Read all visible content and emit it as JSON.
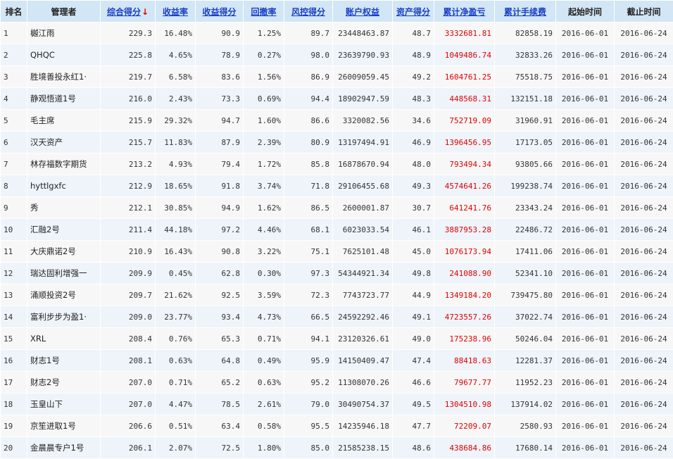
{
  "table": {
    "headers": {
      "rank": "排名",
      "manager": "管理者",
      "composite": "综合得分",
      "composite_arrow": "↓",
      "return_rate": "收益率",
      "return_score": "收益得分",
      "drawdown": "回撤率",
      "risk_score": "风控得分",
      "equity": "账户权益",
      "asset_score": "资产得分",
      "net_pnl": "累计净盈亏",
      "fees": "累计手续费",
      "start": "起始时间",
      "end": "截止时间"
    },
    "rows": [
      {
        "rank": "1",
        "manager": "樾江雨",
        "composite": "229.3",
        "return_rate": "16.48%",
        "return_score": "90.9",
        "drawdown": "1.25%",
        "risk_score": "89.7",
        "equity": "23448463.87",
        "asset_score": "48.7",
        "net_pnl": "3332681.81",
        "fees": "82858.19",
        "start": "2016-06-01",
        "end": "2016-06-24"
      },
      {
        "rank": "2",
        "manager": "QHQC",
        "composite": "225.8",
        "return_rate": "4.65%",
        "return_score": "78.9",
        "drawdown": "0.27%",
        "risk_score": "98.0",
        "equity": "23639790.93",
        "asset_score": "48.9",
        "net_pnl": "1049486.74",
        "fees": "32833.26",
        "start": "2016-06-01",
        "end": "2016-06-24"
      },
      {
        "rank": "3",
        "manager": "胜境善投永红1·",
        "composite": "219.7",
        "return_rate": "6.58%",
        "return_score": "83.6",
        "drawdown": "1.56%",
        "risk_score": "86.9",
        "equity": "26009059.45",
        "asset_score": "49.2",
        "net_pnl": "1604761.25",
        "fees": "75518.75",
        "start": "2016-06-01",
        "end": "2016-06-24"
      },
      {
        "rank": "4",
        "manager": "静观悟道1号",
        "composite": "216.0",
        "return_rate": "2.43%",
        "return_score": "73.3",
        "drawdown": "0.69%",
        "risk_score": "94.4",
        "equity": "18902947.59",
        "asset_score": "48.3",
        "net_pnl": "448568.31",
        "fees": "132151.18",
        "start": "2016-06-01",
        "end": "2016-06-24"
      },
      {
        "rank": "5",
        "manager": "毛主席",
        "composite": "215.9",
        "return_rate": "29.32%",
        "return_score": "94.7",
        "drawdown": "1.60%",
        "risk_score": "86.6",
        "equity": "3320082.56",
        "asset_score": "34.6",
        "net_pnl": "752719.09",
        "fees": "31960.91",
        "start": "2016-06-01",
        "end": "2016-06-24"
      },
      {
        "rank": "6",
        "manager": "汉天资产",
        "composite": "215.7",
        "return_rate": "11.83%",
        "return_score": "87.9",
        "drawdown": "2.39%",
        "risk_score": "80.9",
        "equity": "13197494.91",
        "asset_score": "46.9",
        "net_pnl": "1396456.95",
        "fees": "17173.05",
        "start": "2016-06-01",
        "end": "2016-06-24"
      },
      {
        "rank": "7",
        "manager": "林存福数字期货",
        "composite": "213.2",
        "return_rate": "4.93%",
        "return_score": "79.4",
        "drawdown": "1.72%",
        "risk_score": "85.8",
        "equity": "16878670.94",
        "asset_score": "48.0",
        "net_pnl": "793494.34",
        "fees": "93805.66",
        "start": "2016-06-01",
        "end": "2016-06-24"
      },
      {
        "rank": "8",
        "manager": "hyttlgxfc",
        "composite": "212.9",
        "return_rate": "18.65%",
        "return_score": "91.8",
        "drawdown": "3.74%",
        "risk_score": "71.8",
        "equity": "29106455.68",
        "asset_score": "49.3",
        "net_pnl": "4574641.26",
        "fees": "199238.74",
        "start": "2016-06-01",
        "end": "2016-06-24"
      },
      {
        "rank": "9",
        "manager": "秀",
        "composite": "212.1",
        "return_rate": "30.85%",
        "return_score": "94.9",
        "drawdown": "1.62%",
        "risk_score": "86.5",
        "equity": "2600001.87",
        "asset_score": "30.7",
        "net_pnl": "641241.76",
        "fees": "23343.24",
        "start": "2016-06-01",
        "end": "2016-06-24"
      },
      {
        "rank": "10",
        "manager": "汇融2号",
        "composite": "211.4",
        "return_rate": "44.18%",
        "return_score": "97.2",
        "drawdown": "4.46%",
        "risk_score": "68.1",
        "equity": "6023033.54",
        "asset_score": "46.1",
        "net_pnl": "3887953.28",
        "fees": "22486.72",
        "start": "2016-06-01",
        "end": "2016-06-24"
      },
      {
        "rank": "11",
        "manager": "大庆鼎诺2号",
        "composite": "210.9",
        "return_rate": "16.43%",
        "return_score": "90.8",
        "drawdown": "3.22%",
        "risk_score": "75.1",
        "equity": "7625101.48",
        "asset_score": "45.0",
        "net_pnl": "1076173.94",
        "fees": "17411.06",
        "start": "2016-06-01",
        "end": "2016-06-24"
      },
      {
        "rank": "12",
        "manager": "瑞达固利增强一",
        "composite": "209.9",
        "return_rate": "0.45%",
        "return_score": "62.8",
        "drawdown": "0.30%",
        "risk_score": "97.3",
        "equity": "54344921.34",
        "asset_score": "49.8",
        "net_pnl": "241088.90",
        "fees": "52341.10",
        "start": "2016-06-01",
        "end": "2016-06-24"
      },
      {
        "rank": "13",
        "manager": "涌顺投资2号",
        "composite": "209.7",
        "return_rate": "21.62%",
        "return_score": "92.5",
        "drawdown": "3.59%",
        "risk_score": "72.3",
        "equity": "7743723.77",
        "asset_score": "44.9",
        "net_pnl": "1349184.20",
        "fees": "739475.80",
        "start": "2016-06-01",
        "end": "2016-06-24"
      },
      {
        "rank": "14",
        "manager": "富利步步为盈1·",
        "composite": "209.0",
        "return_rate": "23.77%",
        "return_score": "93.4",
        "drawdown": "4.73%",
        "risk_score": "66.5",
        "equity": "24592292.46",
        "asset_score": "49.1",
        "net_pnl": "4723557.26",
        "fees": "37022.74",
        "start": "2016-06-01",
        "end": "2016-06-24"
      },
      {
        "rank": "15",
        "manager": "XRL",
        "composite": "208.4",
        "return_rate": "0.76%",
        "return_score": "65.3",
        "drawdown": "0.71%",
        "risk_score": "94.1",
        "equity": "23120326.61",
        "asset_score": "49.0",
        "net_pnl": "175238.96",
        "fees": "50246.04",
        "start": "2016-06-01",
        "end": "2016-06-24"
      },
      {
        "rank": "16",
        "manager": "财志1号",
        "composite": "208.1",
        "return_rate": "0.63%",
        "return_score": "64.8",
        "drawdown": "0.49%",
        "risk_score": "95.9",
        "equity": "14150409.47",
        "asset_score": "47.4",
        "net_pnl": "88418.63",
        "fees": "12281.37",
        "start": "2016-06-01",
        "end": "2016-06-24"
      },
      {
        "rank": "17",
        "manager": "财志2号",
        "composite": "207.0",
        "return_rate": "0.71%",
        "return_score": "65.2",
        "drawdown": "0.63%",
        "risk_score": "95.2",
        "equity": "11308070.26",
        "asset_score": "46.6",
        "net_pnl": "79677.77",
        "fees": "11952.23",
        "start": "2016-06-01",
        "end": "2016-06-24"
      },
      {
        "rank": "18",
        "manager": "玉皇山下",
        "composite": "207.0",
        "return_rate": "4.47%",
        "return_score": "78.5",
        "drawdown": "2.61%",
        "risk_score": "79.0",
        "equity": "30490754.37",
        "asset_score": "49.5",
        "net_pnl": "1304510.98",
        "fees": "137914.02",
        "start": "2016-06-01",
        "end": "2016-06-24"
      },
      {
        "rank": "19",
        "manager": "京笙进取1号",
        "composite": "206.6",
        "return_rate": "0.51%",
        "return_score": "63.4",
        "drawdown": "0.58%",
        "risk_score": "95.5",
        "equity": "14235946.18",
        "asset_score": "47.7",
        "net_pnl": "72209.07",
        "fees": "2580.93",
        "start": "2016-06-01",
        "end": "2016-06-24"
      },
      {
        "rank": "20",
        "manager": "金晨晨专户1号",
        "composite": "206.1",
        "return_rate": "2.07%",
        "return_score": "72.5",
        "drawdown": "1.80%",
        "risk_score": "85.0",
        "equity": "21585238.15",
        "asset_score": "48.6",
        "net_pnl": "438684.86",
        "fees": "17680.14",
        "start": "2016-06-01",
        "end": "2016-06-24"
      }
    ]
  }
}
